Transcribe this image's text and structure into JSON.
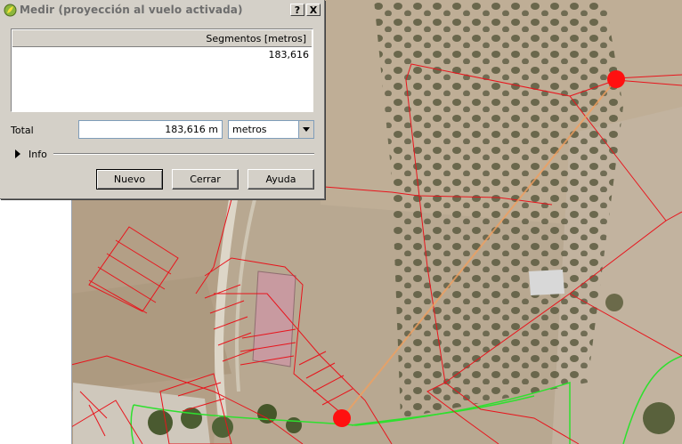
{
  "dialog": {
    "title": "Medir (proyección al vuelo activada)",
    "help_button": "?",
    "close_button": "X",
    "segments_header": "Segmentos [metros]",
    "segments": [
      "183,616"
    ],
    "total_label": "Total",
    "total_value": "183,616 m",
    "units_selected": "metros",
    "info_label": "Info",
    "buttons": {
      "new": "Nuevo",
      "close": "Cerrar",
      "help": "Ayuda"
    }
  },
  "map": {
    "parcel_color": "#e8141c",
    "road_color": "#2ee02e",
    "measure_line_color": "#f0a060",
    "vertex_color": "#ff1010"
  }
}
